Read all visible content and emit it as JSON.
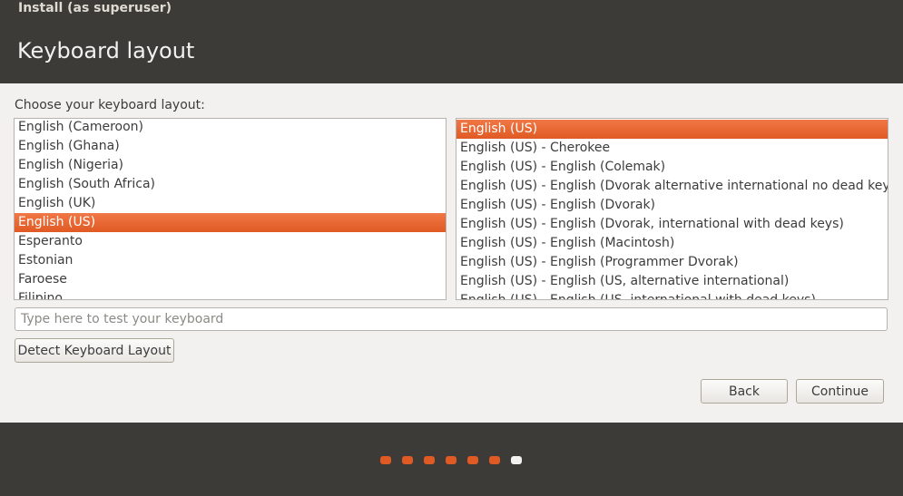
{
  "window": {
    "title": "Install (as superuser)"
  },
  "page": {
    "title": "Keyboard layout"
  },
  "prompt": "Choose your keyboard layout:",
  "layouts": [
    {
      "label": "English (Cameroon)",
      "selected": false
    },
    {
      "label": "English (Ghana)",
      "selected": false
    },
    {
      "label": "English (Nigeria)",
      "selected": false
    },
    {
      "label": "English (South Africa)",
      "selected": false
    },
    {
      "label": "English (UK)",
      "selected": false
    },
    {
      "label": "English (US)",
      "selected": true
    },
    {
      "label": "Esperanto",
      "selected": false
    },
    {
      "label": "Estonian",
      "selected": false
    },
    {
      "label": "Faroese",
      "selected": false
    },
    {
      "label": "Filipino",
      "selected": false
    }
  ],
  "variants": [
    {
      "label": "English (US)",
      "selected": true
    },
    {
      "label": "English (US) - Cherokee",
      "selected": false
    },
    {
      "label": "English (US) - English (Colemak)",
      "selected": false
    },
    {
      "label": "English (US) - English (Dvorak alternative international no dead keys)",
      "selected": false
    },
    {
      "label": "English (US) - English (Dvorak)",
      "selected": false
    },
    {
      "label": "English (US) - English (Dvorak, international with dead keys)",
      "selected": false
    },
    {
      "label": "English (US) - English (Macintosh)",
      "selected": false
    },
    {
      "label": "English (US) - English (Programmer Dvorak)",
      "selected": false
    },
    {
      "label": "English (US) - English (US, alternative international)",
      "selected": false
    },
    {
      "label": "English (US) - English (US, international with dead keys)",
      "selected": false
    }
  ],
  "test_input": {
    "placeholder": "Type here to test your keyboard",
    "value": ""
  },
  "buttons": {
    "detect": "Detect Keyboard Layout",
    "back": "Back",
    "continue": "Continue"
  },
  "progress": {
    "total_steps": 7,
    "current_step": 7,
    "done_color": "#e05a23",
    "current_color": "#f2f1f0"
  },
  "colors": {
    "accent": "#e05a23",
    "header_bg": "#3c3b37",
    "body_bg": "#f2f1f0"
  }
}
